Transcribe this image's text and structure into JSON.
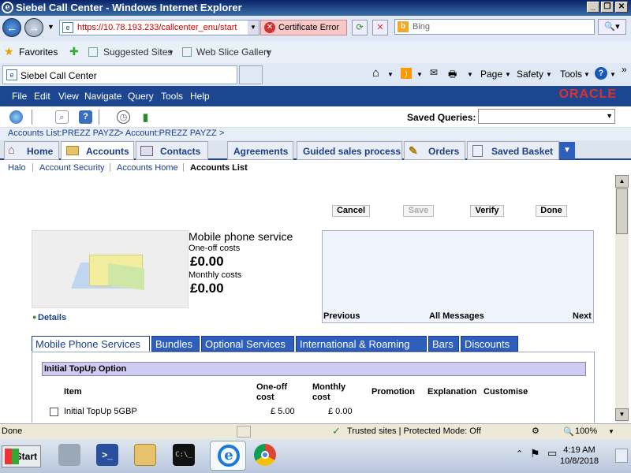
{
  "window": {
    "title": "Siebel Call Center - Windows Internet Explorer"
  },
  "address": {
    "url": "https://10.78.193.233/callcenter_enu/start",
    "cert_error": "Certificate Error",
    "search_placeholder": "Bing"
  },
  "favorites": {
    "label": "Favorites",
    "items": [
      "Suggested Sites",
      "Web Slice Gallery"
    ]
  },
  "tab": {
    "title": "Siebel Call Center"
  },
  "commandbar": {
    "page": "Page",
    "safety": "Safety",
    "tools": "Tools"
  },
  "menu": {
    "items": [
      "File",
      "Edit",
      "View",
      "Navigate",
      "Query",
      "Tools",
      "Help"
    ],
    "brand": "ORACLE"
  },
  "toolbar": {
    "saved_queries_label": "Saved Queries:"
  },
  "breadcrumb": {
    "items": [
      "Accounts List:PREZZ PAYZZ",
      "> Account:PREZZ PAYZZ",
      ">"
    ]
  },
  "app_tabs": [
    {
      "label": "Home"
    },
    {
      "label": "Accounts"
    },
    {
      "label": "Contacts"
    },
    {
      "label": "Agreements"
    },
    {
      "label": "Guided sales process"
    },
    {
      "label": "Orders"
    },
    {
      "label": "Saved Basket"
    }
  ],
  "subnav": {
    "items": [
      "Halo",
      "Account Security",
      "Accounts Home",
      "Accounts List"
    ]
  },
  "actions": {
    "cancel": "Cancel",
    "save": "Save",
    "verify": "Verify",
    "done": "Done"
  },
  "product": {
    "title": "Mobile phone service",
    "oneoff_label": "One-off costs",
    "oneoff_value": "£0.00",
    "monthly_label": "Monthly costs",
    "monthly_value": "£0.00",
    "details_link": "Details"
  },
  "messages": {
    "previous": "Previous",
    "all": "All Messages",
    "next": "Next"
  },
  "service_tabs": [
    "Mobile Phone Services",
    "Bundles",
    "Optional Services",
    "International & Roaming",
    "Bars",
    "Discounts"
  ],
  "option": {
    "header": "Initial TopUp Option",
    "columns": {
      "item": "Item",
      "oneoff_line1": "One-off",
      "oneoff_line2": "cost",
      "monthly_line1": "Monthly",
      "monthly_line2": "cost",
      "promotion": "Promotion",
      "explanation": "Explanation",
      "customise": "Customise"
    },
    "rows": [
      {
        "item": "Initial TopUp 5GBP",
        "oneoff": "£ 5.00",
        "monthly": "£ 0.00"
      }
    ]
  },
  "status": {
    "left": "Done",
    "zone": "Trusted sites | Protected Mode: Off",
    "zoom": "100%"
  },
  "taskbar": {
    "start": "Start",
    "time": "4:19 AM",
    "date": "10/8/2018"
  },
  "colors": {
    "menu_bg": "#1c4690",
    "oracle_red": "#e03030",
    "option_header_bg": "#d0cbf2",
    "service_tab_bg": "#2e5fbd"
  }
}
